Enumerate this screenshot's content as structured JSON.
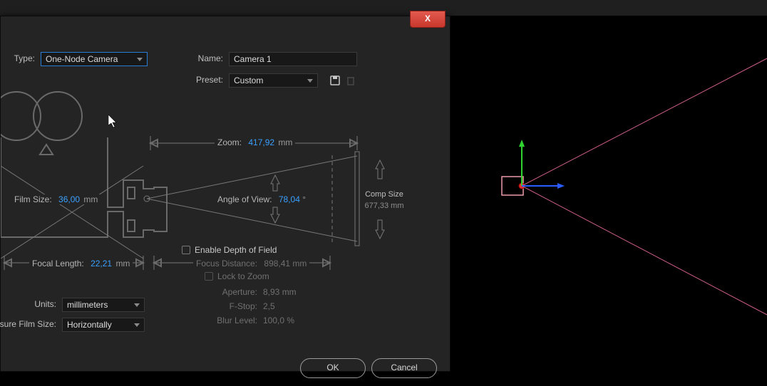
{
  "dialog": {
    "labels": {
      "type": "Type:",
      "name": "Name:",
      "preset": "Preset:",
      "units": "Units:",
      "measure": "Measure Film Size:",
      "filmSize": "Film Size:",
      "zoom": "Zoom:",
      "angleOfView": "Angle of View:",
      "compSize": "Comp Size",
      "focalLength": "Focal Length:",
      "enableDOF": "Enable Depth of Field",
      "focusDistance": "Focus Distance:",
      "lockToZoom": "Lock to Zoom",
      "aperture": "Aperture:",
      "fstop": "F-Stop:",
      "blurLevel": "Blur Level:"
    },
    "values": {
      "type": "One-Node Camera",
      "name": "Camera 1",
      "preset": "Custom",
      "units": "millimeters",
      "measure": "Horizontally",
      "filmSize": "36,00",
      "filmSizeUnit": "mm",
      "zoom": "417,92",
      "zoomUnit": "mm",
      "angleOfView": "78,04",
      "compSize": "677,33 mm",
      "focalLength": "22,21",
      "focalLengthUnit": "mm",
      "focusDistance": "898,41 mm",
      "aperture": "8,93 mm",
      "fstop": "2,5",
      "blurLevel": "100,0 %"
    },
    "buttons": {
      "ok": "OK",
      "cancel": "Cancel"
    },
    "close": "X"
  }
}
